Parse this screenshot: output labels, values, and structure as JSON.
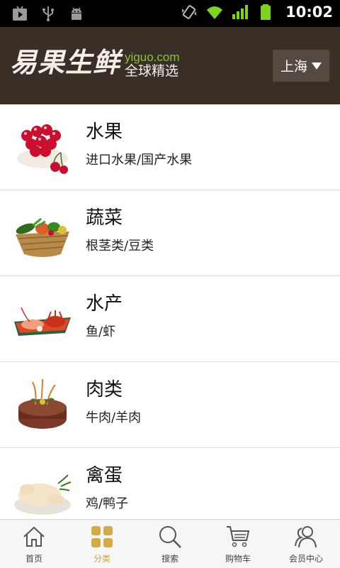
{
  "status_bar": {
    "time": "10:02",
    "left_icons": [
      "play-store-icon",
      "usb-icon",
      "android-debug-icon"
    ],
    "right_icons": [
      "vibrate-icon",
      "wifi-icon",
      "signal-icon",
      "battery-icon"
    ]
  },
  "header": {
    "logo_text": "易果生鲜",
    "logo_url": "yiguo.com",
    "logo_tagline": "全球精选",
    "city": "上海",
    "background": "#3a2f27"
  },
  "categories": [
    {
      "title": "水果",
      "subtitle": "进口水果/国产水果",
      "icon": "cherries-image"
    },
    {
      "title": "蔬菜",
      "subtitle": "根茎类/豆类",
      "icon": "vegetable-basket-image"
    },
    {
      "title": "水产",
      "subtitle": "鱼/虾",
      "icon": "seafood-platter-image"
    },
    {
      "title": "肉类",
      "subtitle": "牛肉/羊肉",
      "icon": "steak-image"
    },
    {
      "title": "禽蛋",
      "subtitle": "鸡/鸭子",
      "icon": "poultry-image"
    }
  ],
  "tabs": [
    {
      "label": "首页",
      "icon": "home-icon",
      "active": false
    },
    {
      "label": "分类",
      "icon": "grid-icon",
      "active": true
    },
    {
      "label": "搜索",
      "icon": "search-icon",
      "active": false
    },
    {
      "label": "购物车",
      "icon": "cart-icon",
      "active": false
    },
    {
      "label": "会员中心",
      "icon": "users-icon",
      "active": false
    }
  ],
  "colors": {
    "accent": "#c9a444",
    "tab_inactive": "#444444"
  }
}
